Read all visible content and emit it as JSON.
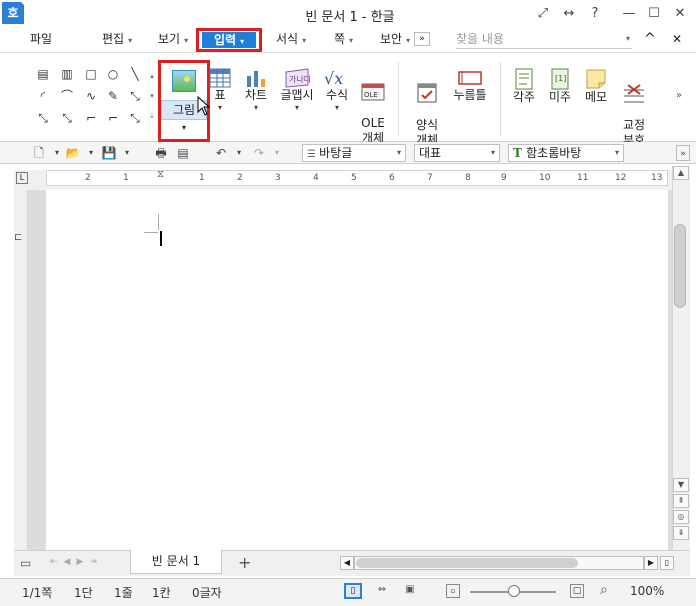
{
  "window": {
    "app_icon": "호",
    "title": "빈 문서 1 - 한글",
    "buttons": [
      "⤢",
      "↔",
      "?",
      "—",
      "☐",
      "✕"
    ]
  },
  "menubar": {
    "items": [
      "파일",
      "편집",
      "보기",
      "입력",
      "서식",
      "쪽",
      "보안"
    ],
    "more": "»",
    "search_placeholder": "찾을 내용",
    "right_buttons": [
      "^",
      "✕"
    ]
  },
  "ribbon": {
    "picture_label": "그림",
    "buttons": [
      {
        "label": "표"
      },
      {
        "label": "차트"
      },
      {
        "label": "글맵시"
      },
      {
        "label": "수식"
      },
      {
        "label": "OLE\n개체"
      },
      {
        "label": "양식\n개체"
      },
      {
        "label": "누름틀"
      },
      {
        "label": "각주"
      },
      {
        "label": "미주"
      },
      {
        "label": "메모"
      },
      {
        "label": "교정\n부호"
      }
    ],
    "more": "»"
  },
  "toolbar": {
    "style_combo": "바탕글",
    "language_combo": "대표",
    "font_combo": "함초롬바탕"
  },
  "ruler": {
    "numbers": [
      "2",
      "1",
      "1",
      "2",
      "3",
      "4",
      "5",
      "6",
      "7",
      "8",
      "9",
      "10",
      "11",
      "12",
      "13"
    ]
  },
  "tabs": {
    "doc_tab": "빈 문서 1",
    "add": "+"
  },
  "status": {
    "page": "1/1쪽",
    "column": "1단",
    "line": "1줄",
    "col_pos": "1칸",
    "chars": "0글자",
    "zoom": "100%"
  }
}
